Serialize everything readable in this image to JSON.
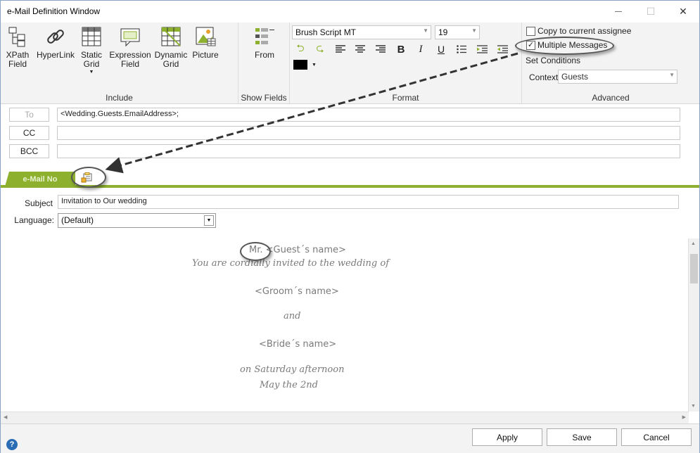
{
  "window": {
    "title": "e-Mail Definition Window",
    "controls": {
      "minimize": "—",
      "maximize": "☐",
      "close": "✕"
    }
  },
  "ribbon": {
    "include": {
      "label": "Include",
      "buttons": [
        {
          "line1": "XPath",
          "line2": "Field",
          "icon": "xpath-field-icon"
        },
        {
          "line1": "HyperLink",
          "line2": "",
          "icon": "hyperlink-icon"
        },
        {
          "line1": "Static",
          "line2": "Grid",
          "icon": "static-grid-icon"
        },
        {
          "line1": "Expression",
          "line2": "Field",
          "icon": "expression-field-icon"
        },
        {
          "line1": "Dynamic",
          "line2": "Grid",
          "icon": "dynamic-grid-icon"
        },
        {
          "line1": "Picture",
          "line2": "",
          "icon": "picture-icon"
        }
      ]
    },
    "show_fields": {
      "label": "Show Fields",
      "from_label": "From"
    },
    "format": {
      "label": "Format",
      "font": "Brush Script MT",
      "size": "19",
      "bold": "B",
      "italic": "I",
      "underline": "U",
      "color": "#000000"
    },
    "advanced": {
      "label": "Advanced",
      "copy_assignee": "Copy to current assignee",
      "copy_checked": false,
      "multiple_messages": "Multiple Messages",
      "multiple_checked": true,
      "check_mark": "✓",
      "set_conditions": "Set Conditions",
      "context_label": "Context",
      "context_value": "Guests"
    }
  },
  "addresses": {
    "to_label": "To",
    "to_value": "<Wedding.Guests.EmailAddress>;",
    "cc_label": "CC",
    "cc_value": "",
    "bcc_label": "BCC",
    "bcc_value": ""
  },
  "tab": {
    "label": "e-Mail No"
  },
  "subject": {
    "label": "Subject",
    "value": "Invitation to Our wedding"
  },
  "language": {
    "label": "Language:",
    "value": "(Default)"
  },
  "body": {
    "lines": [
      "Mr. <Guest´s name>",
      "You are cordially invited to the wedding of",
      "<Groom´s name>",
      "and",
      "<Bride´s name>",
      "on Saturday afternoon",
      "May the 2nd"
    ]
  },
  "footer": {
    "help": "?",
    "apply": "Apply",
    "save": "Save",
    "cancel": "Cancel"
  },
  "colors": {
    "accent": "#8db12f",
    "ribbon_bg": "#f3f3f3",
    "body_text": "#7a7a7a"
  }
}
